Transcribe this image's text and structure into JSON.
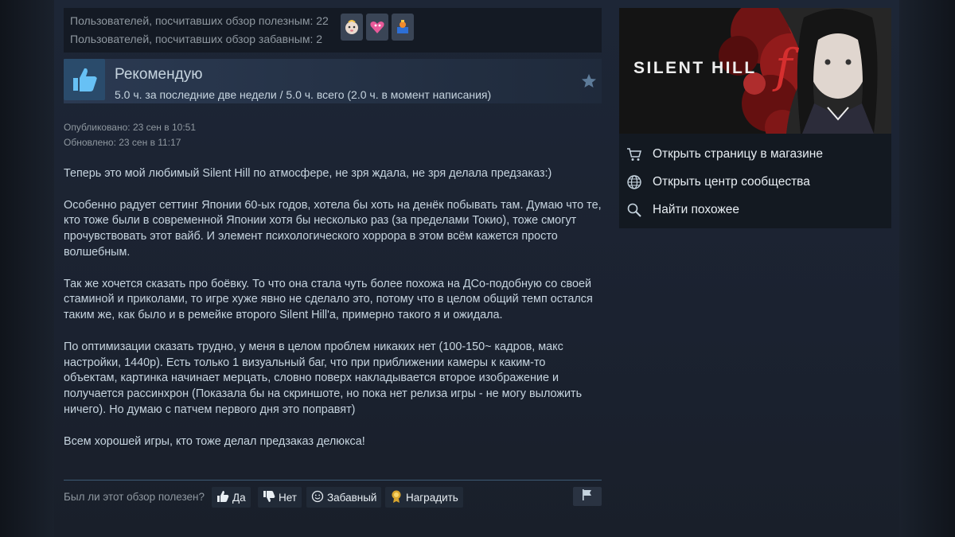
{
  "review": {
    "votes": {
      "helpful": "Пользователей, посчитавших обзор полезным: 22",
      "funny": "Пользователей, посчитавших обзор забавным: 2"
    },
    "awards": [
      {
        "icon": "baby-face-award-icon",
        "color": "#e9d7c9"
      },
      {
        "icon": "pink-heart-award-icon",
        "color": "#e95a9a"
      },
      {
        "icon": "treasure-award-icon",
        "color": "#f08a2c"
      }
    ],
    "recommendation": "Рекомендую",
    "hours": "5.0 ч. за последние две недели / 5.0 ч. всего (2.0 ч. в момент написания)",
    "published": "Опубликовано: 23 сен в 10:51",
    "updated": "Обновлено: 23 сен в 11:17",
    "paragraphs": [
      "Теперь это мой любимый Silent Hill по атмосфере, не зря ждала, не зря делала предзаказ:)",
      "Особенно радует сеттинг Японии 60-ых годов, хотела бы хоть на денёк побывать там. Думаю что те, кто тоже были в современной Японии хотя бы несколько раз (за пределами Токио), тоже смогут прочувствовать этот вайб. И элемент психологического хоррора в этом всём кажется просто волшебным.",
      "Так же хочется сказать про боёвку. То что она стала чуть более похожа на ДСо-подобную со своей стаминой и приколами, то игре хуже явно не сделало это, потому что в целом общий темп остался таким же, как было и в ремейке второго Silent Hill'a, примерно такого я и ожидала.",
      "По оптимизации сказать трудно, у меня в целом проблем никаких нет (100-150~ кадров, макс настройки, 1440p). Есть только 1 визуальный баг, что при приближении камеры к каким-то объектам, картинка начинает мерцать, словно поверх накладывается второе изображение и получается рассинхрон (Показала бы на скриншоте, но пока нет релиза игры - не могу выложить ничего). Но думаю с патчем первого дня это поправят)",
      "Всем хорошей игры, кто тоже делал предзаказ делюкса!"
    ],
    "footer": {
      "question": "Был ли этот обзор полезен?",
      "yes": "Да",
      "no": "Нет",
      "funny": "Забавный",
      "award": "Наградить"
    }
  },
  "sidebar": {
    "game_logo": "SILENT HILL",
    "game_logo_suffix": "f",
    "links": [
      {
        "label": "Открыть страницу в магазине",
        "icon": "cart-icon"
      },
      {
        "label": "Открыть центр сообщества",
        "icon": "globe-icon"
      },
      {
        "label": "Найти похожее",
        "icon": "search-icon"
      }
    ]
  },
  "colors": {
    "accent_blue": "#67c1f5",
    "text": "#c6d4df",
    "muted": "#8f98a0",
    "banner_red": "#d62f2f"
  }
}
